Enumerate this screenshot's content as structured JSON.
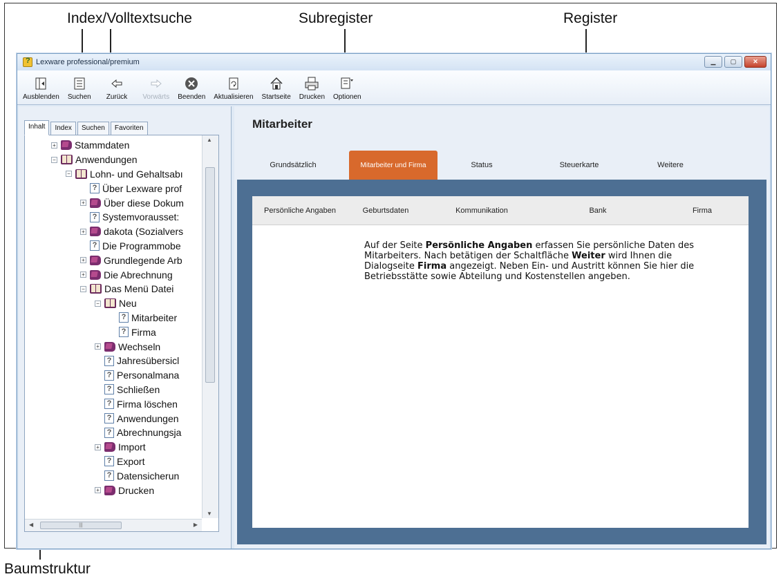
{
  "annotations": {
    "index_search": "Index/Volltextsuche",
    "subregister": "Subregister",
    "register": "Register",
    "tree": "Baumstruktur"
  },
  "window": {
    "title": "Lexware professional/premium",
    "controls": [
      "minimize",
      "maximize",
      "close"
    ]
  },
  "toolbar": [
    {
      "label": "Ausblenden",
      "icon": "hide-pane-icon",
      "enabled": true
    },
    {
      "label": "Suchen",
      "icon": "search-panel-icon",
      "enabled": true
    },
    {
      "label": "Zurück",
      "icon": "back-arrow-icon",
      "enabled": true
    },
    {
      "label": "Vorwärts",
      "icon": "forward-arrow-icon",
      "enabled": false
    },
    {
      "label": "Beenden",
      "icon": "stop-icon",
      "enabled": true
    },
    {
      "label": "Aktualisieren",
      "icon": "refresh-icon",
      "enabled": true
    },
    {
      "label": "Startseite",
      "icon": "home-icon",
      "enabled": true
    },
    {
      "label": "Drucken",
      "icon": "printer-icon",
      "enabled": true
    },
    {
      "label": "Optionen",
      "icon": "options-icon",
      "enabled": true
    }
  ],
  "left_tabs": [
    {
      "label": "Inhalt",
      "active": true
    },
    {
      "label": "Index",
      "active": false
    },
    {
      "label": "Suchen",
      "active": false
    },
    {
      "label": "Favoriten",
      "active": false
    }
  ],
  "tree": [
    {
      "label": "Stammdaten",
      "icon": "book-closed",
      "level": 0,
      "expander": "+"
    },
    {
      "label": "Anwendungen",
      "icon": "book-open",
      "level": 0,
      "expander": "-"
    },
    {
      "label": "Lohn- und Gehaltsabı",
      "icon": "book-open",
      "level": 1,
      "expander": "-"
    },
    {
      "label": "Über Lexware prof",
      "icon": "page",
      "level": 2,
      "expander": ""
    },
    {
      "label": "Über diese Dokum",
      "icon": "book-closed",
      "level": 2,
      "expander": "+"
    },
    {
      "label": "Systemvorausset:",
      "icon": "page",
      "level": 2,
      "expander": ""
    },
    {
      "label": "dakota (Sozialvers",
      "icon": "book-closed",
      "level": 2,
      "expander": "+"
    },
    {
      "label": "Die Programmobe",
      "icon": "page",
      "level": 2,
      "expander": ""
    },
    {
      "label": "Grundlegende Arb",
      "icon": "book-closed",
      "level": 2,
      "expander": "+"
    },
    {
      "label": "Die Abrechnung",
      "icon": "book-closed",
      "level": 2,
      "expander": "+"
    },
    {
      "label": "Das Menü Datei",
      "icon": "book-open",
      "level": 2,
      "expander": "-"
    },
    {
      "label": "Neu",
      "icon": "book-open",
      "level": 3,
      "expander": "-"
    },
    {
      "label": "Mitarbeiter",
      "icon": "page",
      "level": 4,
      "expander": ""
    },
    {
      "label": "Firma",
      "icon": "page",
      "level": 4,
      "expander": ""
    },
    {
      "label": "Wechseln",
      "icon": "book-closed",
      "level": 3,
      "expander": "+"
    },
    {
      "label": "Jahresübersicl",
      "icon": "page",
      "level": 3,
      "expander": ""
    },
    {
      "label": "Personalmana",
      "icon": "page",
      "level": 3,
      "expander": ""
    },
    {
      "label": "Schließen",
      "icon": "page",
      "level": 3,
      "expander": ""
    },
    {
      "label": "Firma löschen",
      "icon": "page",
      "level": 3,
      "expander": ""
    },
    {
      "label": "Anwendungen",
      "icon": "page",
      "level": 3,
      "expander": ""
    },
    {
      "label": "Abrechnungsja",
      "icon": "page",
      "level": 3,
      "expander": ""
    },
    {
      "label": "Import",
      "icon": "book-closed",
      "level": 3,
      "expander": "+"
    },
    {
      "label": "Export",
      "icon": "page",
      "level": 3,
      "expander": ""
    },
    {
      "label": "Datensicherun",
      "icon": "page",
      "level": 3,
      "expander": ""
    },
    {
      "label": "Drucken",
      "icon": "book-closed",
      "level": 3,
      "expander": "+"
    }
  ],
  "content": {
    "title": "Mitarbeiter",
    "register_tabs": [
      {
        "label": "Grundsätzlich",
        "active": false
      },
      {
        "label": "Mitarbeiter und Firma",
        "active": true
      },
      {
        "label": "Status",
        "active": false
      },
      {
        "label": "Steuerkarte",
        "active": false
      },
      {
        "label": "Weitere",
        "active": false
      }
    ],
    "sub_tabs": [
      "Persönliche Angaben",
      "Geburtsdaten",
      "Kommunikation",
      "Bank",
      "Firma"
    ],
    "text": {
      "p1": "Auf der Seite ",
      "b1": "Persönliche Angaben",
      "p2": " erfassen Sie persönliche Daten des Mitarbeiters. Nach betätigen der Schaltfläche ",
      "b2": "Weiter",
      "p3": " wird Ihnen die Dialogseite ",
      "b3": "Firma",
      "p4": " angezeigt. Neben Ein- und Austritt können Sie hier die Betriebsstätte sowie Abteilung und Kostenstellen angeben."
    }
  },
  "colors": {
    "active_tab": "#d8692c",
    "content_frame": "#4d6f93",
    "book_closed": "#7b2d6e"
  }
}
